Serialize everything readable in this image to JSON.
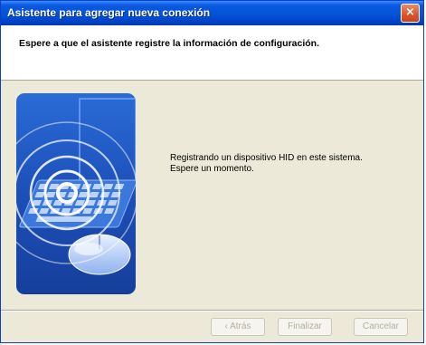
{
  "window": {
    "title": "Asistente para agregar nueva conexión",
    "close_glyph": "×"
  },
  "header": {
    "instruction": "Espere a que el asistente registre la información de configuración."
  },
  "main": {
    "message_line1": "Registrando un dispositivo HID en este sistema.",
    "message_line2": "Espere un momento.",
    "illustration": "wireless-keyboard-mouse-illustration"
  },
  "footer": {
    "back_label": "‹ Atrás",
    "finish_label": "Finalizar",
    "cancel_label": "Cancelar",
    "buttons_enabled": false
  },
  "colors": {
    "titlebar": "#0354d6",
    "dialog_background": "#ece9d8",
    "illustration_blue": "#1d4fb8"
  }
}
